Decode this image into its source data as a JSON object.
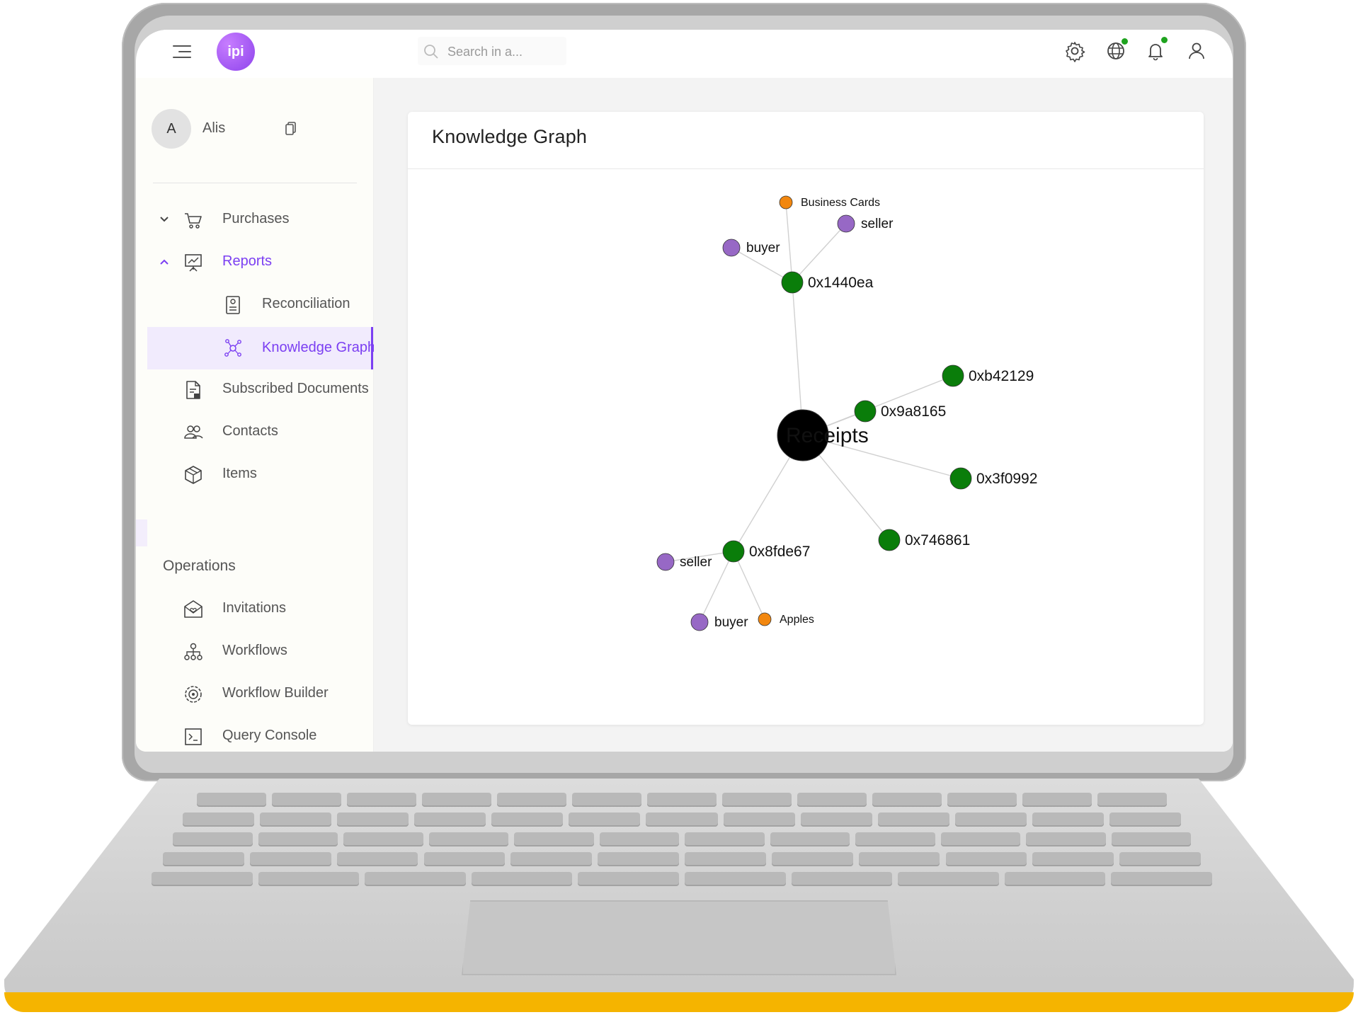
{
  "header": {
    "logo_text": "ipi",
    "search_placeholder": "Search in a...",
    "icons": [
      "settings-icon",
      "globe-icon",
      "bell-icon",
      "user-icon"
    ],
    "status_dot_color": "#1fa31f"
  },
  "sidebar": {
    "user": {
      "initial": "A",
      "name": "Alis"
    },
    "items": [
      {
        "label": "Purchases",
        "icon": "cart-icon",
        "expandable": true,
        "expanded": false
      },
      {
        "label": "Reports",
        "icon": "presentation-chart-icon",
        "expandable": true,
        "expanded": true
      },
      {
        "label": "Reconciliation",
        "icon": "report-document-icon"
      },
      {
        "label": "Knowledge Graph",
        "icon": "graph-network-icon",
        "active": true
      },
      {
        "label": "Subscribed Documents",
        "icon": "subscribed-document-icon"
      },
      {
        "label": "Contacts",
        "icon": "contacts-icon"
      },
      {
        "label": "Items",
        "icon": "cube-icon"
      }
    ],
    "operations_title": "Operations",
    "operations": [
      {
        "label": "Invitations",
        "icon": "invitation-mail-icon"
      },
      {
        "label": "Workflows",
        "icon": "workflow-icon"
      },
      {
        "label": "Workflow Builder",
        "icon": "workflow-builder-gear-icon"
      },
      {
        "label": "Query Console",
        "icon": "terminal-icon"
      }
    ]
  },
  "page": {
    "title": "Knowledge Graph"
  },
  "graph": {
    "colors": {
      "root": "#000000",
      "transaction": "#0a7d0a",
      "role": "#9768c5",
      "item": "#f2870f",
      "edge": "#d0d0d0"
    },
    "nodes": [
      {
        "id": "receipts",
        "label": "Receipts",
        "kind": "root"
      },
      {
        "id": "tx1",
        "label": "0x1440ea",
        "kind": "transaction"
      },
      {
        "id": "tx2",
        "label": "0xb42129",
        "kind": "transaction"
      },
      {
        "id": "tx3",
        "label": "0x9a8165",
        "kind": "transaction"
      },
      {
        "id": "tx4",
        "label": "0x3f0992",
        "kind": "transaction"
      },
      {
        "id": "tx5",
        "label": "0x746861",
        "kind": "transaction"
      },
      {
        "id": "tx6",
        "label": "0x8fde67",
        "kind": "transaction"
      },
      {
        "id": "r1",
        "label": "buyer",
        "kind": "role"
      },
      {
        "id": "r2",
        "label": "seller",
        "kind": "role"
      },
      {
        "id": "r3",
        "label": "seller",
        "kind": "role"
      },
      {
        "id": "r4",
        "label": "buyer",
        "kind": "role"
      },
      {
        "id": "i1",
        "label": "Business Cards",
        "kind": "item"
      },
      {
        "id": "i2",
        "label": "Apples",
        "kind": "item"
      }
    ],
    "edges": [
      [
        "receipts",
        "tx1"
      ],
      [
        "receipts",
        "tx2"
      ],
      [
        "receipts",
        "tx3"
      ],
      [
        "receipts",
        "tx4"
      ],
      [
        "receipts",
        "tx5"
      ],
      [
        "receipts",
        "tx6"
      ],
      [
        "tx1",
        "r1"
      ],
      [
        "tx1",
        "r2"
      ],
      [
        "tx1",
        "i1"
      ],
      [
        "tx6",
        "r3"
      ],
      [
        "tx6",
        "r4"
      ],
      [
        "tx6",
        "i2"
      ]
    ]
  }
}
